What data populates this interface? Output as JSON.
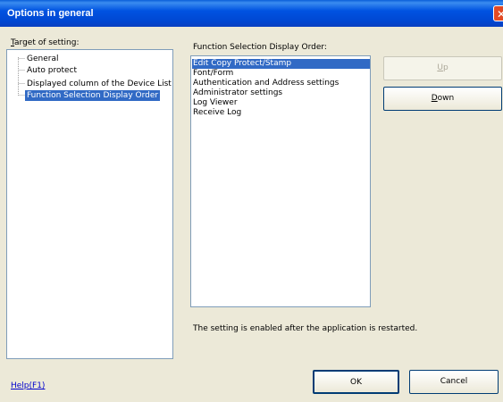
{
  "window": {
    "title": "Options in general",
    "close_glyph": "✕"
  },
  "target": {
    "label_first": "T",
    "label_rest": "arget of setting:",
    "items": [
      {
        "label": "General"
      },
      {
        "label": "Auto protect"
      },
      {
        "label": "Displayed column of the Device List"
      },
      {
        "label": "Function Selection Display Order",
        "selected": true
      }
    ]
  },
  "order": {
    "label": "Function Selection Display Order:",
    "items": [
      {
        "label": "Edit Copy Protect/Stamp",
        "selected": true
      },
      {
        "label": "Font/Form"
      },
      {
        "label": "Authentication and Address settings"
      },
      {
        "label": "Administrator settings"
      },
      {
        "label": "Log Viewer"
      },
      {
        "label": "Receive Log"
      }
    ]
  },
  "buttons": {
    "up_first": "U",
    "up_rest": "p",
    "down_first": "D",
    "down_rest": "own",
    "ok": "OK",
    "cancel": "Cancel"
  },
  "note": "The setting is enabled after the application is restarted.",
  "help": "Help(F1)",
  "colors": {
    "selection": "#316ac5",
    "titlebar": "#0047d1",
    "dialog_bg": "#ece9d8"
  }
}
